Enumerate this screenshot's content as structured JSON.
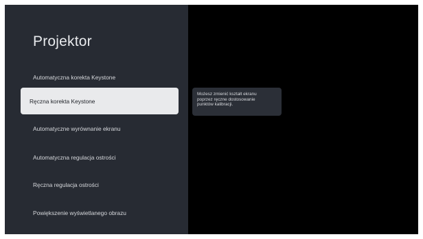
{
  "screen": {
    "title": "Projektor",
    "menu": [
      {
        "label": "Automatyczna korekta Keystone",
        "selected": false
      },
      {
        "label": "Ręczna korekta Keystone",
        "selected": true
      },
      {
        "label": "Automatyczne wyrównanie ekranu",
        "selected": false
      },
      {
        "label": "Automatyczna regulacja ostrości",
        "selected": false
      },
      {
        "label": "Ręczna regulacja ostrości",
        "selected": false
      },
      {
        "label": "Powiększenie wyświetlanego obrazu",
        "selected": false
      }
    ],
    "tooltip": "Możesz zmienić kształt ekranu\npoprzez ręczne dostosowanie\npunktów kalibracji."
  },
  "colors": {
    "panel_bg": "#272b33",
    "screen_bg": "#000000",
    "selected_bg": "#e9eaec",
    "tooltip_bg": "#2b2f37"
  }
}
